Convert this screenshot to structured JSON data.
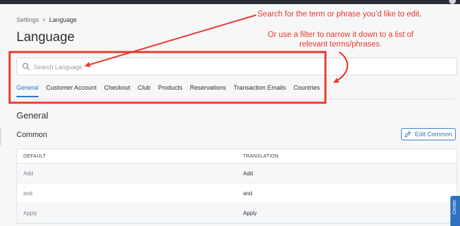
{
  "breadcrumb": {
    "parent": "Settings",
    "separator": ">",
    "current": "Language"
  },
  "page": {
    "title": "Language"
  },
  "search": {
    "placeholder": "Search Language",
    "value": ""
  },
  "tabs": [
    {
      "label": "General",
      "active": true
    },
    {
      "label": "Customer Account",
      "active": false
    },
    {
      "label": "Checkout",
      "active": false
    },
    {
      "label": "Club",
      "active": false
    },
    {
      "label": "Products",
      "active": false
    },
    {
      "label": "Reservations",
      "active": false
    },
    {
      "label": "Transaction Emails",
      "active": false
    },
    {
      "label": "Countries",
      "active": false
    }
  ],
  "section": {
    "title": "General",
    "subtitle": "Common"
  },
  "actions": {
    "edit_label": "Edit Common"
  },
  "table": {
    "headers": {
      "default": "DEFAULT",
      "translation": "TRANSLATION"
    },
    "rows": [
      {
        "default": "Add",
        "translation": "Add"
      },
      {
        "default": "and",
        "translation": "and"
      },
      {
        "default": "Apply",
        "translation": "Apply"
      }
    ]
  },
  "help_tab": {
    "label": "Center"
  },
  "annotations": {
    "callout_1": "Search for the term or phrase you’d like to edit.",
    "callout_2_line1": "Or use a filter to narrow it down to a list of",
    "callout_2_line2": "relevant terms/phrases."
  },
  "colors": {
    "accent": "#2f73bf",
    "annotation": "#e8392b"
  },
  "icons": {
    "search": "search-icon",
    "edit": "pencil-icon"
  }
}
